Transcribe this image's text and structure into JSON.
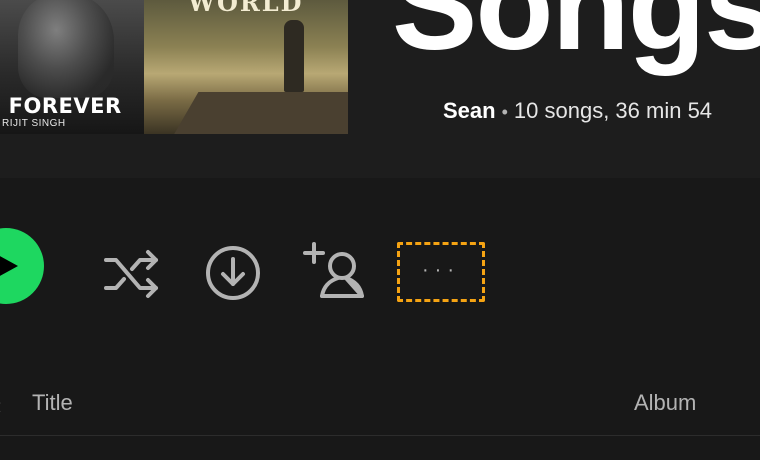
{
  "header": {
    "title": "Songs",
    "owner": "Sean",
    "separator": "•",
    "summary": "10 songs, 36 min 54",
    "covers": [
      {
        "title": "E FOREVER",
        "subtitle": "RIJIT SINGH"
      },
      {
        "title": "WORLD"
      }
    ]
  },
  "controls": {
    "play": "play-icon",
    "shuffle": "shuffle-icon",
    "download": "download-icon",
    "follow": "add-user-icon",
    "more_label": "···"
  },
  "table": {
    "columns": [
      "Title",
      "Album"
    ]
  },
  "colors": {
    "accent": "#1ed760",
    "highlight": "#f5a313",
    "background": "#121212",
    "text_muted": "#b3b3b3"
  }
}
